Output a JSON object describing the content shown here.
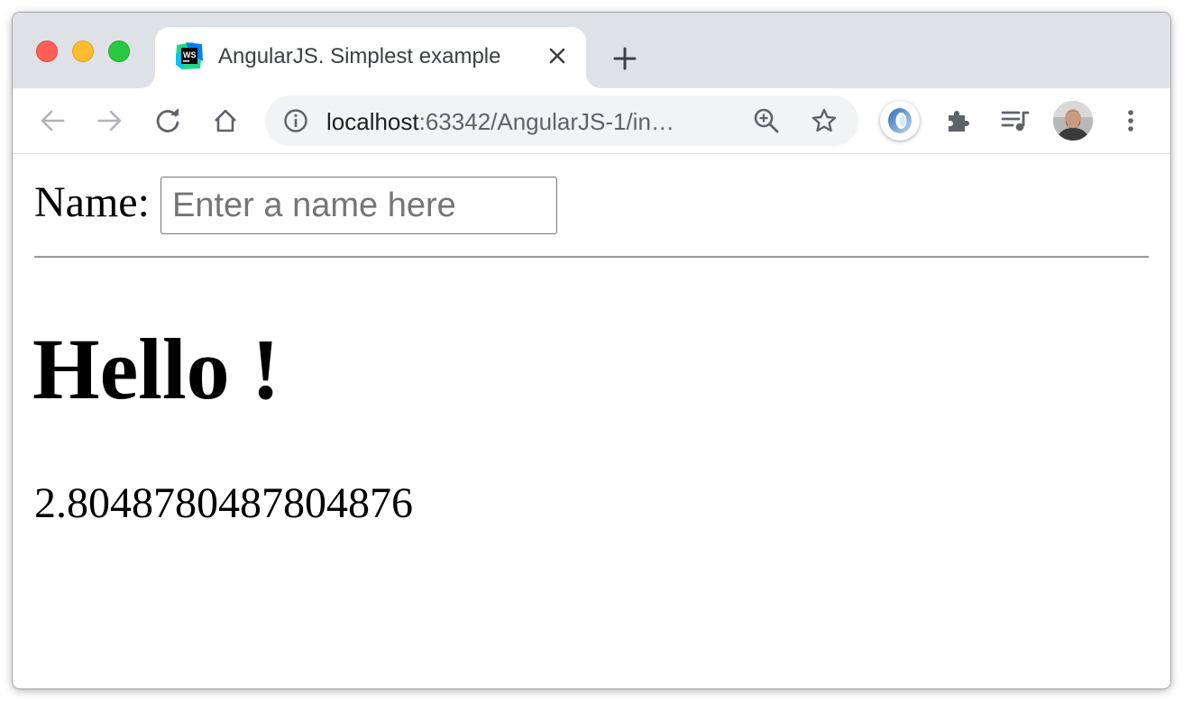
{
  "window": {
    "traffic_lights": [
      "close",
      "minimize",
      "maximize"
    ]
  },
  "tab": {
    "favicon_text": "WS",
    "title": "AngularJS. Simplest example",
    "close_icon": "close-icon"
  },
  "toolbar": {
    "url_host": "localhost",
    "url_rest": ":63342/AngularJS-1/in…",
    "icons": [
      "back-arrow-icon",
      "forward-arrow-icon",
      "reload-icon",
      "home-icon",
      "info-icon",
      "zoom-icon",
      "star-icon",
      "extension-ring-icon",
      "puzzle-icon",
      "media-queue-icon",
      "avatar",
      "kebab-menu-icon"
    ]
  },
  "page": {
    "name_label": "Name:",
    "name_input_value": "",
    "name_input_placeholder": "Enter a name here",
    "hello_text": "Hello !",
    "number_text": "2.8048780487804876"
  },
  "colors": {
    "tabstrip_bg": "#dee1e6",
    "omnibox_bg": "#f1f3f4",
    "icon_gray": "#5f6368"
  }
}
